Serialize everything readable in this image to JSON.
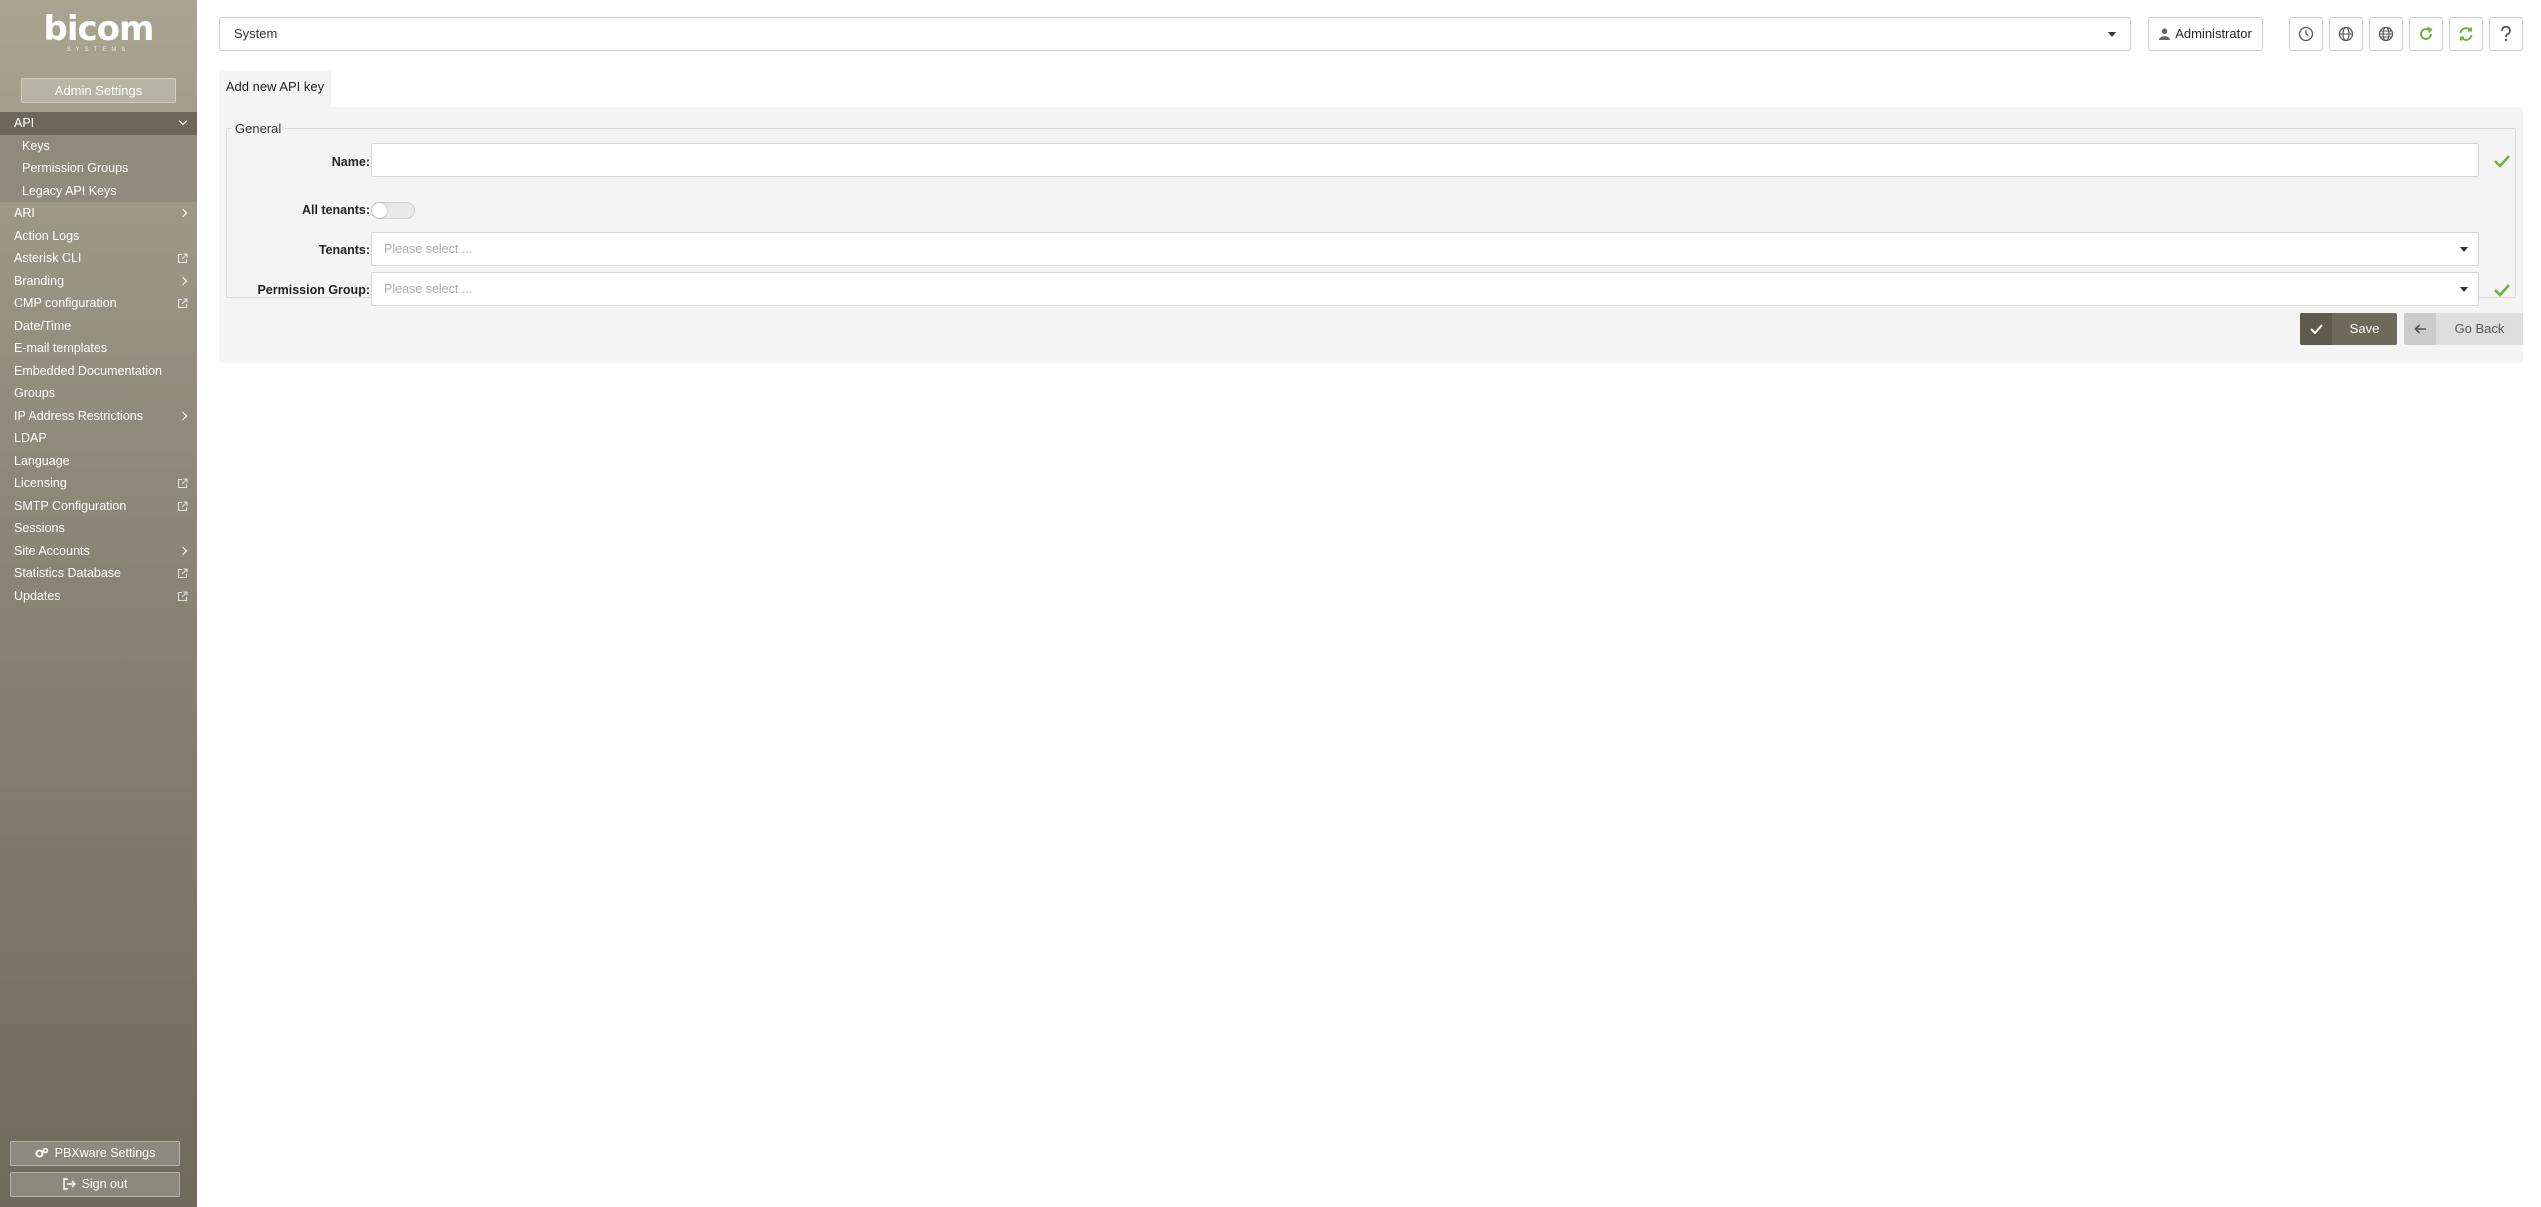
{
  "sidebar": {
    "logo_text": "bicom",
    "logo_sub": "SYSTEMS",
    "section_button": "Admin Settings",
    "items": [
      {
        "label": "API",
        "active": true,
        "icon": "chevron-down-icon"
      },
      {
        "label": "Keys",
        "sub": true
      },
      {
        "label": "Permission Groups",
        "sub": true
      },
      {
        "label": "Legacy API Keys",
        "sub": true
      },
      {
        "label": "ARI",
        "icon": "chevron-right-icon"
      },
      {
        "label": "Action Logs"
      },
      {
        "label": "Asterisk CLI",
        "icon": "external-link-icon"
      },
      {
        "label": "Branding",
        "icon": "chevron-right-icon"
      },
      {
        "label": "CMP configuration",
        "icon": "external-link-icon"
      },
      {
        "label": "Date/Time"
      },
      {
        "label": "E-mail templates"
      },
      {
        "label": "Embedded Documentation"
      },
      {
        "label": "Groups"
      },
      {
        "label": "IP Address Restrictions",
        "icon": "chevron-right-icon"
      },
      {
        "label": "LDAP"
      },
      {
        "label": "Language"
      },
      {
        "label": "Licensing",
        "icon": "external-link-icon"
      },
      {
        "label": "SMTP Configuration",
        "icon": "external-link-icon"
      },
      {
        "label": "Sessions"
      },
      {
        "label": "Site Accounts",
        "icon": "chevron-right-icon"
      },
      {
        "label": "Statistics Database",
        "icon": "external-link-icon"
      },
      {
        "label": "Updates",
        "icon": "external-link-icon"
      }
    ],
    "pbxware_settings": "PBXware Settings",
    "sign_out": "Sign out"
  },
  "topbar": {
    "system_value": "System",
    "user_label": "Administrator",
    "tools": [
      "clock-icon",
      "globe-icon",
      "globe-grid-icon",
      "refresh-icon",
      "sync-icon",
      "help-icon"
    ]
  },
  "content": {
    "tab_label": "Add new API key",
    "fieldset_legend": "General",
    "fields": {
      "name_label": "Name:",
      "name_value": "",
      "all_tenants_label": "All tenants:",
      "all_tenants_on": false,
      "tenants_label": "Tenants:",
      "tenants_placeholder": "Please select ...",
      "permission_group_label": "Permission Group:",
      "permission_group_placeholder": "Please select ..."
    },
    "save_label": "Save",
    "back_label": "Go Back"
  },
  "colors": {
    "sidebar_top": "#a8a490",
    "sidebar_bottom": "#6e6a5c",
    "accent_green": "#6cb33f",
    "save_bg": "#6d6a5c"
  }
}
